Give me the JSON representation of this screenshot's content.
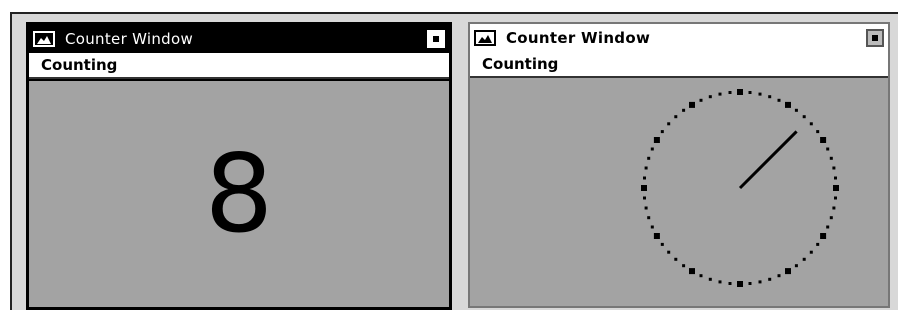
{
  "windows": [
    {
      "title": "Counter Window",
      "menu": [
        "Counting"
      ],
      "display": "digital",
      "value": "8"
    },
    {
      "title": "Counter Window",
      "menu": [
        "Counting"
      ],
      "display": "analog",
      "hand_position_minutes": 7.5
    }
  ],
  "colors": {
    "client_background": "#a3a3a3",
    "active_titlebar": "#000000",
    "inactive_titlebar": "#ffffff"
  }
}
